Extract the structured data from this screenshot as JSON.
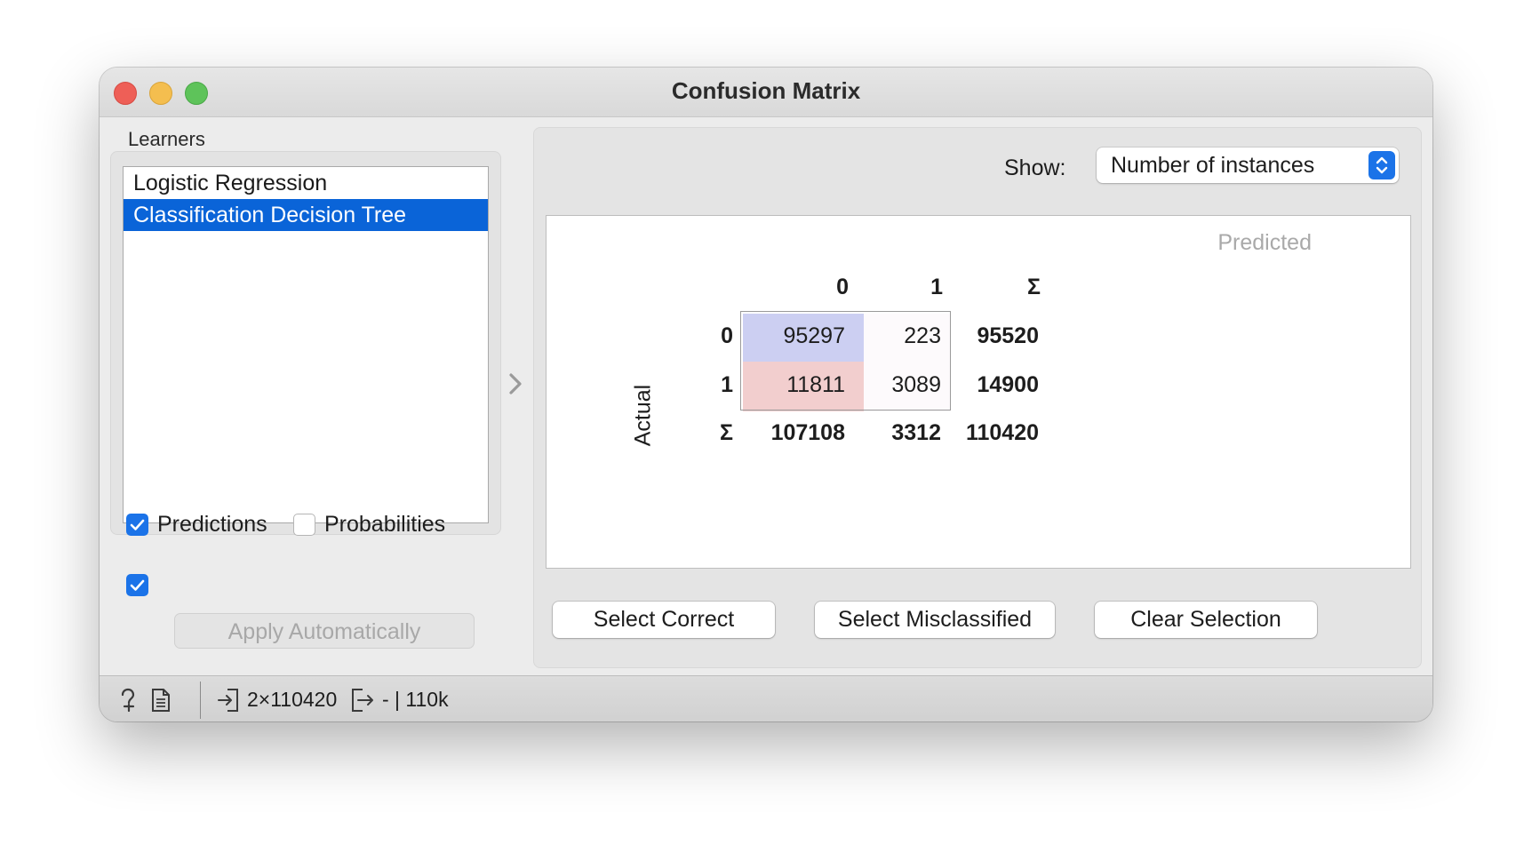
{
  "window": {
    "title": "Confusion Matrix"
  },
  "learners": {
    "label": "Learners",
    "items": [
      {
        "label": "Logistic Regression",
        "selected": false
      },
      {
        "label": "Classification Decision Tree",
        "selected": true
      }
    ]
  },
  "options": {
    "predictions": {
      "label": "Predictions",
      "checked": true
    },
    "probabilities": {
      "label": "Probabilities",
      "checked": false
    },
    "auto_apply": {
      "checked": true,
      "label": "Apply Automatically"
    }
  },
  "show": {
    "label": "Show:",
    "value": "Number of instances"
  },
  "matrix": {
    "predicted_label": "Predicted",
    "actual_label": "Actual",
    "col_headers": [
      "0",
      "1",
      "Σ"
    ],
    "row_headers": [
      "0",
      "1",
      "Σ"
    ],
    "rows": [
      [
        "95297",
        "223",
        "95520"
      ],
      [
        "11811",
        "3089",
        "14900"
      ]
    ],
    "totals": [
      "107108",
      "3312",
      "110420"
    ],
    "colors": {
      "correct": "#cccff2",
      "misclassified": "#f2cece",
      "off_diag_light": "#fdfafc"
    }
  },
  "buttons": {
    "select_correct": "Select Correct",
    "select_misclassified": "Select Misclassified",
    "clear_selection": "Clear Selection"
  },
  "status": {
    "input_summary": "2×110420",
    "output_summary": "- | 110k",
    "icons": [
      "help-icon",
      "report-icon",
      "input-icon",
      "output-icon"
    ]
  },
  "colors": {
    "accent": "#1b73e8",
    "selection": "#0a64d8"
  }
}
